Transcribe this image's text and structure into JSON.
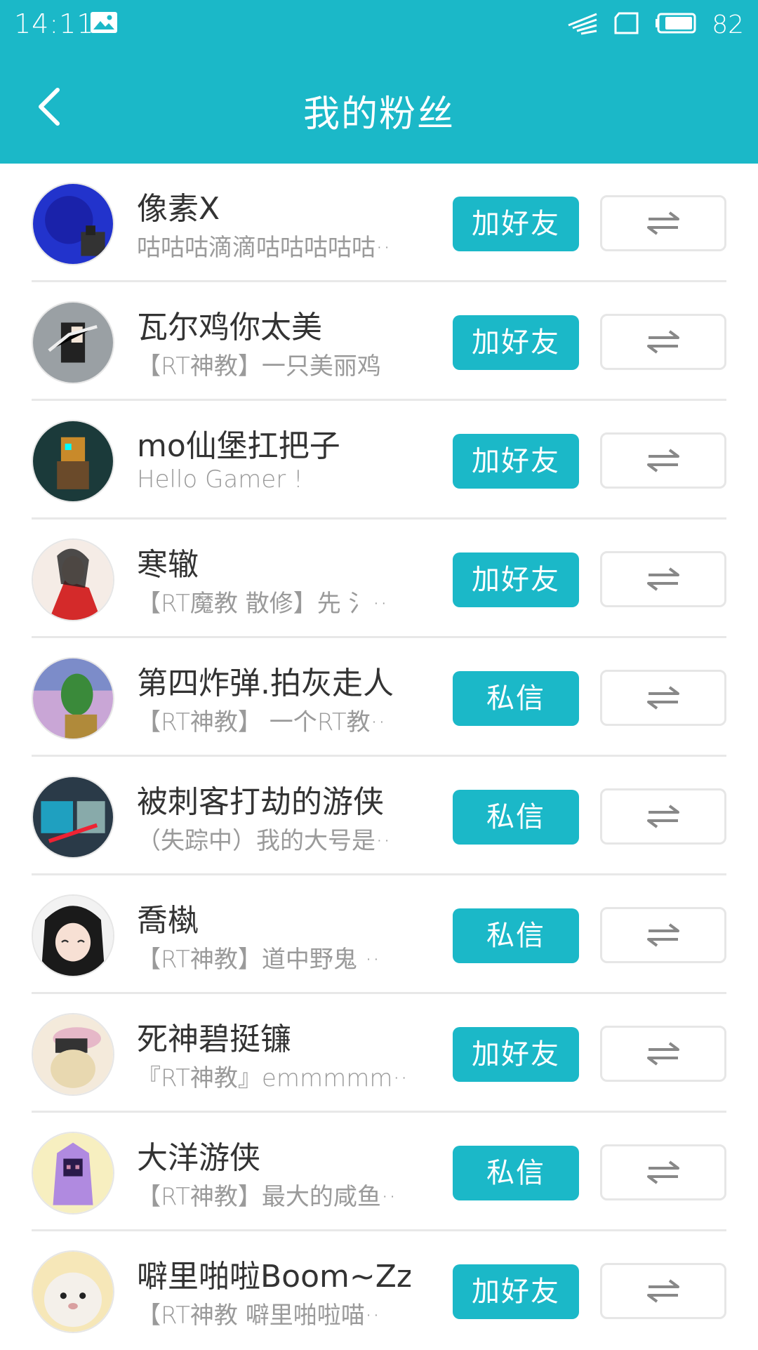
{
  "status_bar": {
    "time": "14:11",
    "battery": "82"
  },
  "header": {
    "title": "我的粉丝",
    "back_icon": "chevron-left-icon"
  },
  "colors": {
    "accent": "#1BB8C8",
    "divider": "#E8E8E8"
  },
  "fans": [
    {
      "name": "像素X",
      "bio": "咕咕咕滴滴咕咕咕咕咕··",
      "action": "加好友"
    },
    {
      "name": "瓦尔鸡你太美",
      "bio": "【RT神教】一只美丽鸡",
      "action": "加好友"
    },
    {
      "name": "mo仙堡扛把子",
      "bio": "Hello Gamer !",
      "action": "加好友"
    },
    {
      "name": "寒辙",
      "bio": "【RT魔教 散修】先 氵··",
      "action": "加好友"
    },
    {
      "name": "第四炸弹.拍灰走人",
      "bio": "【RT神教】  一个RT教··",
      "action": "私信"
    },
    {
      "name": "被刺客打劫的游侠",
      "bio": "（失踪中）我的大号是··",
      "action": "私信"
    },
    {
      "name": "喬槸",
      "bio": "【RT神教】道中野鬼  ··",
      "action": "私信"
    },
    {
      "name": "死神碧挺镰",
      "bio": "『RT神教』emmmmm··",
      "action": "加好友"
    },
    {
      "name": "大洋游侠",
      "bio": "【RT神教】最大的咸鱼··",
      "action": "私信"
    },
    {
      "name": "噼里啪啦Boom~Zz··",
      "bio": "【RT神教 噼里啪啦喵··",
      "action": "加好友"
    }
  ]
}
